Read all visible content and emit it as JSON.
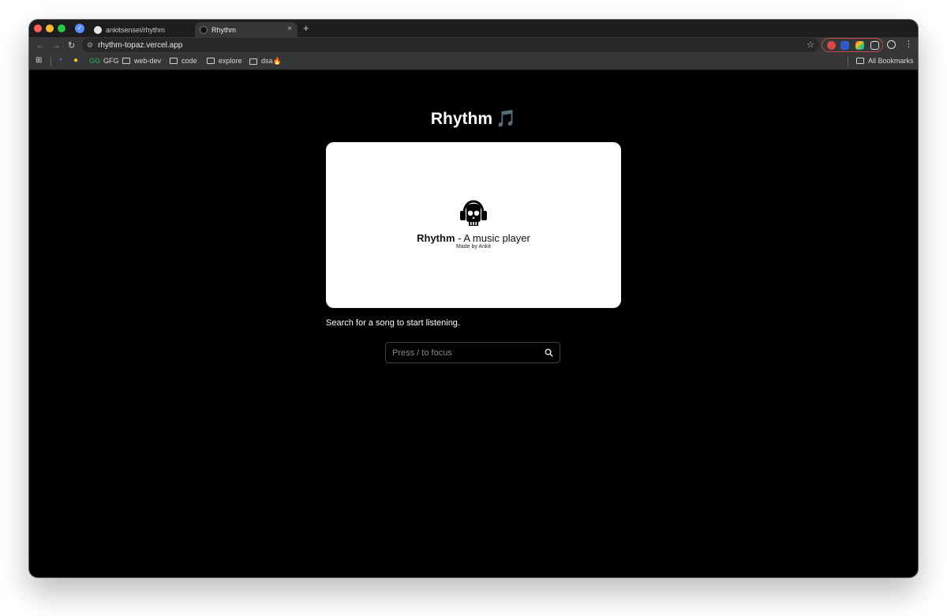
{
  "browser": {
    "tabs": [
      {
        "label": "ankitsensei/rhythm"
      },
      {
        "label": "Rhythm",
        "close": "×"
      }
    ],
    "new_tab": "+",
    "nav": {
      "back": "←",
      "forward": "→",
      "reload": "↻"
    },
    "url": "rhythm-topaz.vercel.app",
    "star": "☆",
    "menu": "⋮",
    "bookmarks": [
      {
        "label": "GFG",
        "mark": "GG"
      },
      {
        "label": "web-dev"
      },
      {
        "label": "code"
      },
      {
        "label": "explore"
      },
      {
        "label": "dsa🔥"
      }
    ],
    "all_bookmarks": "All Bookmarks"
  },
  "page": {
    "title": "Rhythm",
    "title_icon": "🎵",
    "card": {
      "title_bold": "Rhythm",
      "title_rest": " - A music player",
      "subtitle": "Made by Ankit",
      "icon": "skull-headphones-icon"
    },
    "hint": "Search for a song to start listening.",
    "search": {
      "placeholder": "Press / to focus",
      "value": ""
    }
  },
  "colors": {
    "page_bg": "#000000",
    "card_bg": "#ffffff",
    "chrome_bg": "#353638"
  }
}
